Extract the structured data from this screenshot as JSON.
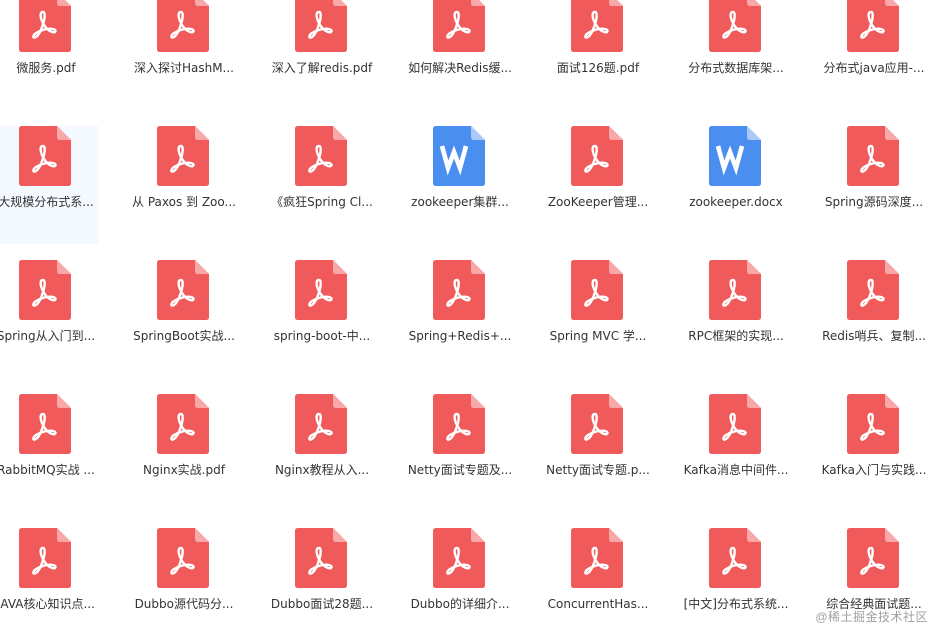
{
  "colors": {
    "pdf": "#f05a5a",
    "pdf_fold": "#f8a8a8",
    "word": "#4a8ef0",
    "word_fold": "#a9c9f8",
    "selection": "#f3f9ff"
  },
  "files": [
    {
      "name": "微服务.pdf",
      "type": "pdf"
    },
    {
      "name": "深入探讨HashM...",
      "type": "pdf"
    },
    {
      "name": "深入了解redis.pdf",
      "type": "pdf"
    },
    {
      "name": "如何解决Redis缓...",
      "type": "pdf"
    },
    {
      "name": "面试126题.pdf",
      "type": "pdf"
    },
    {
      "name": "分布式数据库架...",
      "type": "pdf"
    },
    {
      "name": "分布式java应用-...",
      "type": "pdf"
    },
    {
      "name": "大规模分布式系...",
      "type": "pdf",
      "selected": true
    },
    {
      "name": "从 Paxos 到 Zoo...",
      "type": "pdf"
    },
    {
      "name": "《疯狂Spring Cl...",
      "type": "pdf"
    },
    {
      "name": "zookeeper集群...",
      "type": "word"
    },
    {
      "name": "ZooKeeper管理...",
      "type": "pdf"
    },
    {
      "name": "zookeeper.docx",
      "type": "word"
    },
    {
      "name": "Spring源码深度...",
      "type": "pdf"
    },
    {
      "name": "Spring从入门到...",
      "type": "pdf"
    },
    {
      "name": "SpringBoot实战...",
      "type": "pdf"
    },
    {
      "name": "spring-boot-中...",
      "type": "pdf"
    },
    {
      "name": "Spring+Redis+...",
      "type": "pdf"
    },
    {
      "name": "Spring MVC 学...",
      "type": "pdf"
    },
    {
      "name": "RPC框架的实现...",
      "type": "pdf"
    },
    {
      "name": "Redis哨兵、复制...",
      "type": "pdf"
    },
    {
      "name": "RabbitMQ实战 ...",
      "type": "pdf"
    },
    {
      "name": "Nginx实战.pdf",
      "type": "pdf"
    },
    {
      "name": "Nginx教程从入...",
      "type": "pdf"
    },
    {
      "name": "Netty面试专题及...",
      "type": "pdf"
    },
    {
      "name": "Netty面试专题.p...",
      "type": "pdf"
    },
    {
      "name": "Kafka消息中间件...",
      "type": "pdf"
    },
    {
      "name": "Kafka入门与实践...",
      "type": "pdf"
    },
    {
      "name": "JAVA核心知识点...",
      "type": "pdf"
    },
    {
      "name": "Dubbo源代码分...",
      "type": "pdf"
    },
    {
      "name": "Dubbo面试28题...",
      "type": "pdf"
    },
    {
      "name": "Dubbo的详细介...",
      "type": "pdf"
    },
    {
      "name": "ConcurrentHas...",
      "type": "pdf"
    },
    {
      "name": "[中文]分布式系统...",
      "type": "pdf"
    },
    {
      "name": "综合经典面试题...",
      "type": "pdf"
    }
  ],
  "watermark": "@稀土掘金技术社区"
}
